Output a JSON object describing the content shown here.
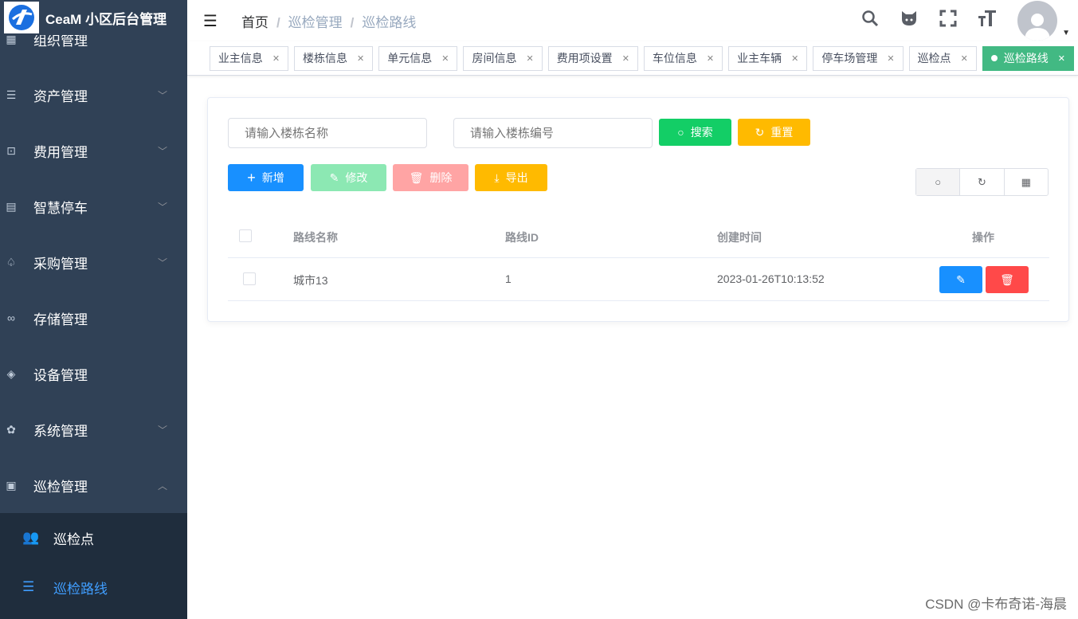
{
  "app": {
    "title": "CeaM 小区后台管理"
  },
  "sidebar": {
    "items": [
      {
        "label": "组织管理",
        "icon": "org-icon"
      },
      {
        "label": "资产管理",
        "icon": "list-icon"
      },
      {
        "label": "费用管理",
        "icon": "chart-icon"
      },
      {
        "label": "智慧停车",
        "icon": "parking-icon"
      },
      {
        "label": "采购管理",
        "icon": "bell-icon"
      },
      {
        "label": "存储管理",
        "icon": "link-icon"
      },
      {
        "label": "设备管理",
        "icon": "device-icon"
      },
      {
        "label": "系统管理",
        "icon": "gear-icon"
      },
      {
        "label": "巡检管理",
        "icon": "calendar-clock-icon"
      }
    ],
    "sub_items": [
      {
        "label": "巡检点",
        "icon": "users-icon"
      },
      {
        "label": "巡检路线",
        "icon": "list-icon"
      }
    ]
  },
  "breadcrumb": [
    "首页",
    "巡检管理",
    "巡检路线"
  ],
  "tags": [
    "业主信息",
    "楼栋信息",
    "单元信息",
    "房间信息",
    "费用项设置",
    "车位信息",
    "业主车辆",
    "停车场管理",
    "巡检点",
    "巡检路线"
  ],
  "search": {
    "name_placeholder": "请输入楼栋名称",
    "code_placeholder": "请输入楼栋编号",
    "search_label": "搜索",
    "reset_label": "重置"
  },
  "actions": {
    "add": "新增",
    "edit": "修改",
    "delete": "删除",
    "export": "导出"
  },
  "table": {
    "headers": [
      "路线名称",
      "路线ID",
      "创建时间",
      "操作"
    ],
    "rows": [
      {
        "name": "城市13",
        "id": "1",
        "created": "2023-01-26T10:13:52"
      }
    ]
  },
  "colors": {
    "sidebar": "#304156",
    "primary": "#1890ff",
    "success": "#13ce66",
    "warning": "#ffba00",
    "danger": "#ff4949",
    "tag_active": "#42b983"
  },
  "watermark": "CSDN @卡布奇诺-海晨"
}
